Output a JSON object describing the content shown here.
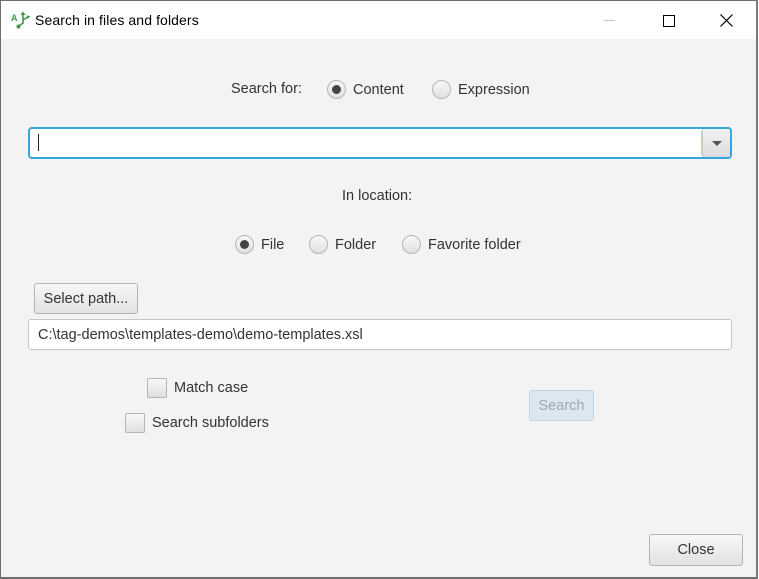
{
  "window": {
    "title": "Search in files and folders",
    "app_icon": "search-files-icon",
    "controls": [
      "minimize-icon",
      "maximize-icon",
      "close-icon"
    ]
  },
  "search_for": {
    "label": "Search for:",
    "options": [
      {
        "label": "Content",
        "selected": true
      },
      {
        "label": "Expression",
        "selected": false
      }
    ]
  },
  "search_input": {
    "value": "",
    "dropdown_icon": "chevron-down-icon"
  },
  "location": {
    "label": "In location:",
    "options": [
      {
        "label": "File",
        "selected": true
      },
      {
        "label": "Folder",
        "selected": false
      },
      {
        "label": "Favorite folder",
        "selected": false
      }
    ]
  },
  "select_path_label": "Select path...",
  "path_value": "C:\\tag-demos\\templates-demo\\demo-templates.xsl",
  "options": {
    "match_case": {
      "label": "Match case",
      "checked": false
    },
    "search_subfolders": {
      "label": "Search subfolders",
      "checked": false
    }
  },
  "search_button": {
    "label": "Search",
    "enabled": false
  },
  "close_button": {
    "label": "Close"
  }
}
